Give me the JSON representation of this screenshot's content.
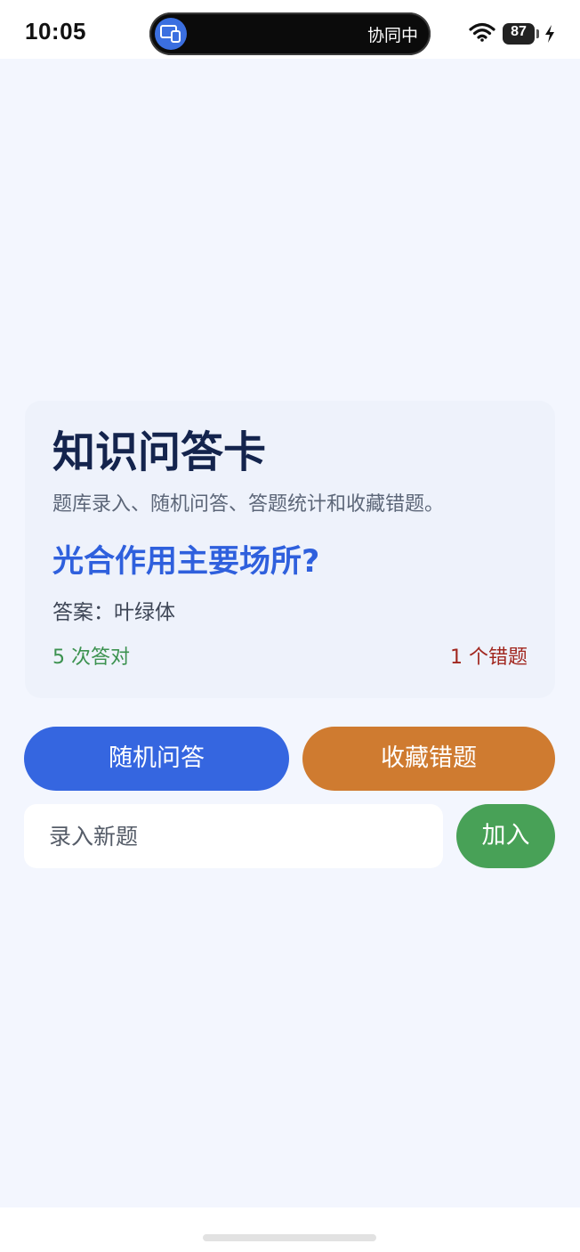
{
  "status_bar": {
    "time": "10:05",
    "collab_text": "协同中",
    "battery_level": "87",
    "icons": [
      "screen-share-icon",
      "wifi-icon",
      "battery-icon",
      "charging-bolt-icon"
    ]
  },
  "card": {
    "title": "知识问答卡",
    "subtitle": "题库录入、随机问答、答题统计和收藏错题。",
    "question": "光合作用主要场所?",
    "answer": "答案：叶绿体",
    "correct_count": "5 次答对",
    "wrong_count": "1 个错题"
  },
  "actions": {
    "random_label": "随机问答",
    "favorite_label": "收藏错题",
    "add_label": "加入"
  },
  "new_question": {
    "placeholder": "录入新题",
    "value": ""
  },
  "colors": {
    "background": "#f3f6fe",
    "card_bg": "#eef2fb",
    "title": "#14244d",
    "question": "#2f60dd",
    "correct": "#3c9250",
    "wrong": "#a1271f",
    "random_button": "#3566e0",
    "favorite_button": "#cf7b30",
    "add_button": "#48a157"
  }
}
